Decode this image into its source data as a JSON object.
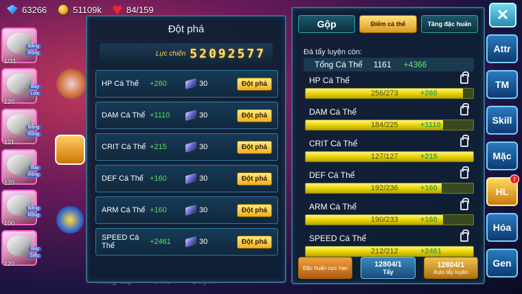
{
  "topbar": {
    "gems": "63266",
    "gold": "51109k",
    "stamina": "84/159"
  },
  "left_monsters": [
    {
      "tag1": "Băng",
      "tag2": "Rồng",
      "level": "1/31"
    },
    {
      "tag1": "Bay",
      "tag2": "Lửa",
      "level": "120"
    },
    {
      "tag1": "Băng",
      "tag2": "Rồng",
      "level": "121"
    },
    {
      "tag1": "Bay",
      "tag2": "Rồng",
      "level": "120"
    },
    {
      "tag1": "Băng",
      "tag2": "Rồng",
      "level": "100"
    },
    {
      "tag1": "Bay",
      "tag2": "Siêu",
      "level": "120"
    }
  ],
  "bottom_labels": [
    "Nâng cấp",
    "theo",
    "Duyên"
  ],
  "dotpha": {
    "title": "Đột phá",
    "power_label": "Lực chiến",
    "power_value": "52092577",
    "rows": [
      {
        "name": "HP Cá Thể",
        "value": "+260",
        "cost": "30",
        "button": "Đột phá"
      },
      {
        "name": "DAM Cá Thể",
        "value": "+1110",
        "cost": "30",
        "button": "Đột phá"
      },
      {
        "name": "CRIT Cá Thể",
        "value": "+215",
        "cost": "30",
        "button": "Đột phá"
      },
      {
        "name": "DEF Cá Thể",
        "value": "+160",
        "cost": "30",
        "button": "Đột phá"
      },
      {
        "name": "ARM Cá Thể",
        "value": "+160",
        "cost": "30",
        "button": "Đột phá"
      },
      {
        "name": "SPEED Cá Thể",
        "value": "+2461",
        "cost": "30",
        "button": "Đột phá"
      }
    ]
  },
  "right_panel": {
    "tabs": [
      "Gộp",
      "Điểm cá thể",
      "Tăng đặc huấn"
    ],
    "remaining_label": "Đá tẩy luyện còn:",
    "total_label": "Tổng Cá Thể",
    "total_value": "1161",
    "total_plus": "+4366",
    "stats": [
      {
        "name": "HP Cá Thể",
        "current": "256/273",
        "plus": "+260",
        "fill": 0.94
      },
      {
        "name": "DAM Cá Thể",
        "current": "184/225",
        "plus": "+1110",
        "fill": 0.82
      },
      {
        "name": "CRIT Cá Thể",
        "current": "127/127",
        "plus": "+215",
        "fill": 1.0
      },
      {
        "name": "DEF Cá Thể",
        "current": "192/236",
        "plus": "+160",
        "fill": 0.81
      },
      {
        "name": "ARM Cá Thể",
        "current": "190/233",
        "plus": "+160",
        "fill": 0.82
      },
      {
        "name": "SPEED Cá Thể",
        "current": "212/212",
        "plus": "+2461",
        "fill": 1.0
      }
    ],
    "buttons": [
      {
        "label": "Đặc huấn cực hạn",
        "count": "",
        "sub": ""
      },
      {
        "label": "",
        "count": "12804/1",
        "sub": "Tẩy"
      },
      {
        "label": "Auto tẩy luyện",
        "count": "12804/1",
        "sub": ""
      }
    ]
  },
  "sidenav": {
    "close": "✕",
    "items": [
      "Attr",
      "TM",
      "Skill",
      "Mặc",
      "HL",
      "Hóa",
      "Gen"
    ],
    "hl_badge": "!"
  }
}
